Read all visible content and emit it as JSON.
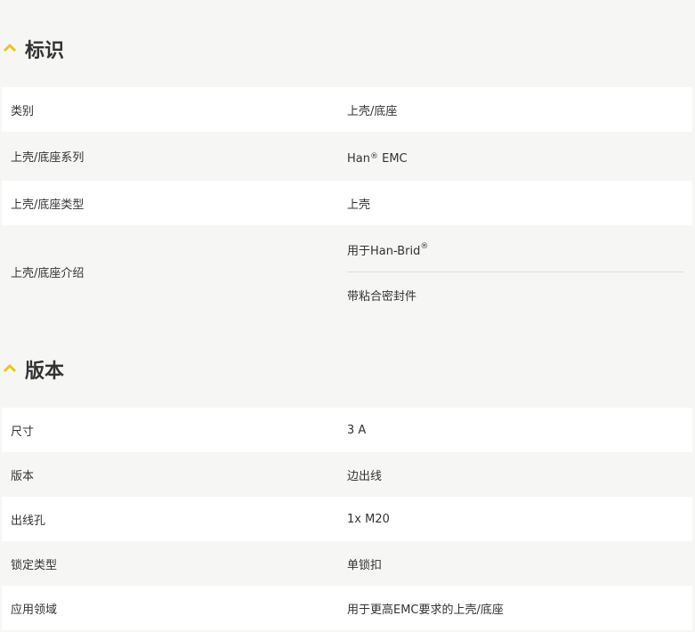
{
  "sections": [
    {
      "title": "标识",
      "rows": [
        {
          "label": "类别",
          "values": [
            "上壳/底座"
          ]
        },
        {
          "label": "上壳/底座系列",
          "values": [
            "Han"
          ],
          "value_sup": "®",
          "value_suffix": " EMC"
        },
        {
          "label": "上壳/底座类型",
          "values": [
            "上壳"
          ]
        },
        {
          "label": "上壳/底座介绍",
          "values": [
            "用于Han-Brid",
            "带粘合密封件"
          ],
          "first_sup": "®"
        }
      ]
    },
    {
      "title": "版本",
      "rows": [
        {
          "label": "尺寸",
          "values": [
            "3 A"
          ]
        },
        {
          "label": "版本",
          "values": [
            "边出线"
          ]
        },
        {
          "label": "出线孔",
          "values": [
            "1x M20"
          ]
        },
        {
          "label": "锁定类型",
          "values": [
            "单锁扣"
          ]
        },
        {
          "label": "应用领域",
          "values": [
            "用于更高EMC要求的上壳/底座"
          ]
        }
      ]
    }
  ],
  "colors": {
    "accent": "#f0c419",
    "row_white": "#ffffff",
    "row_grey": "#f6f6f4",
    "text": "#333333"
  }
}
